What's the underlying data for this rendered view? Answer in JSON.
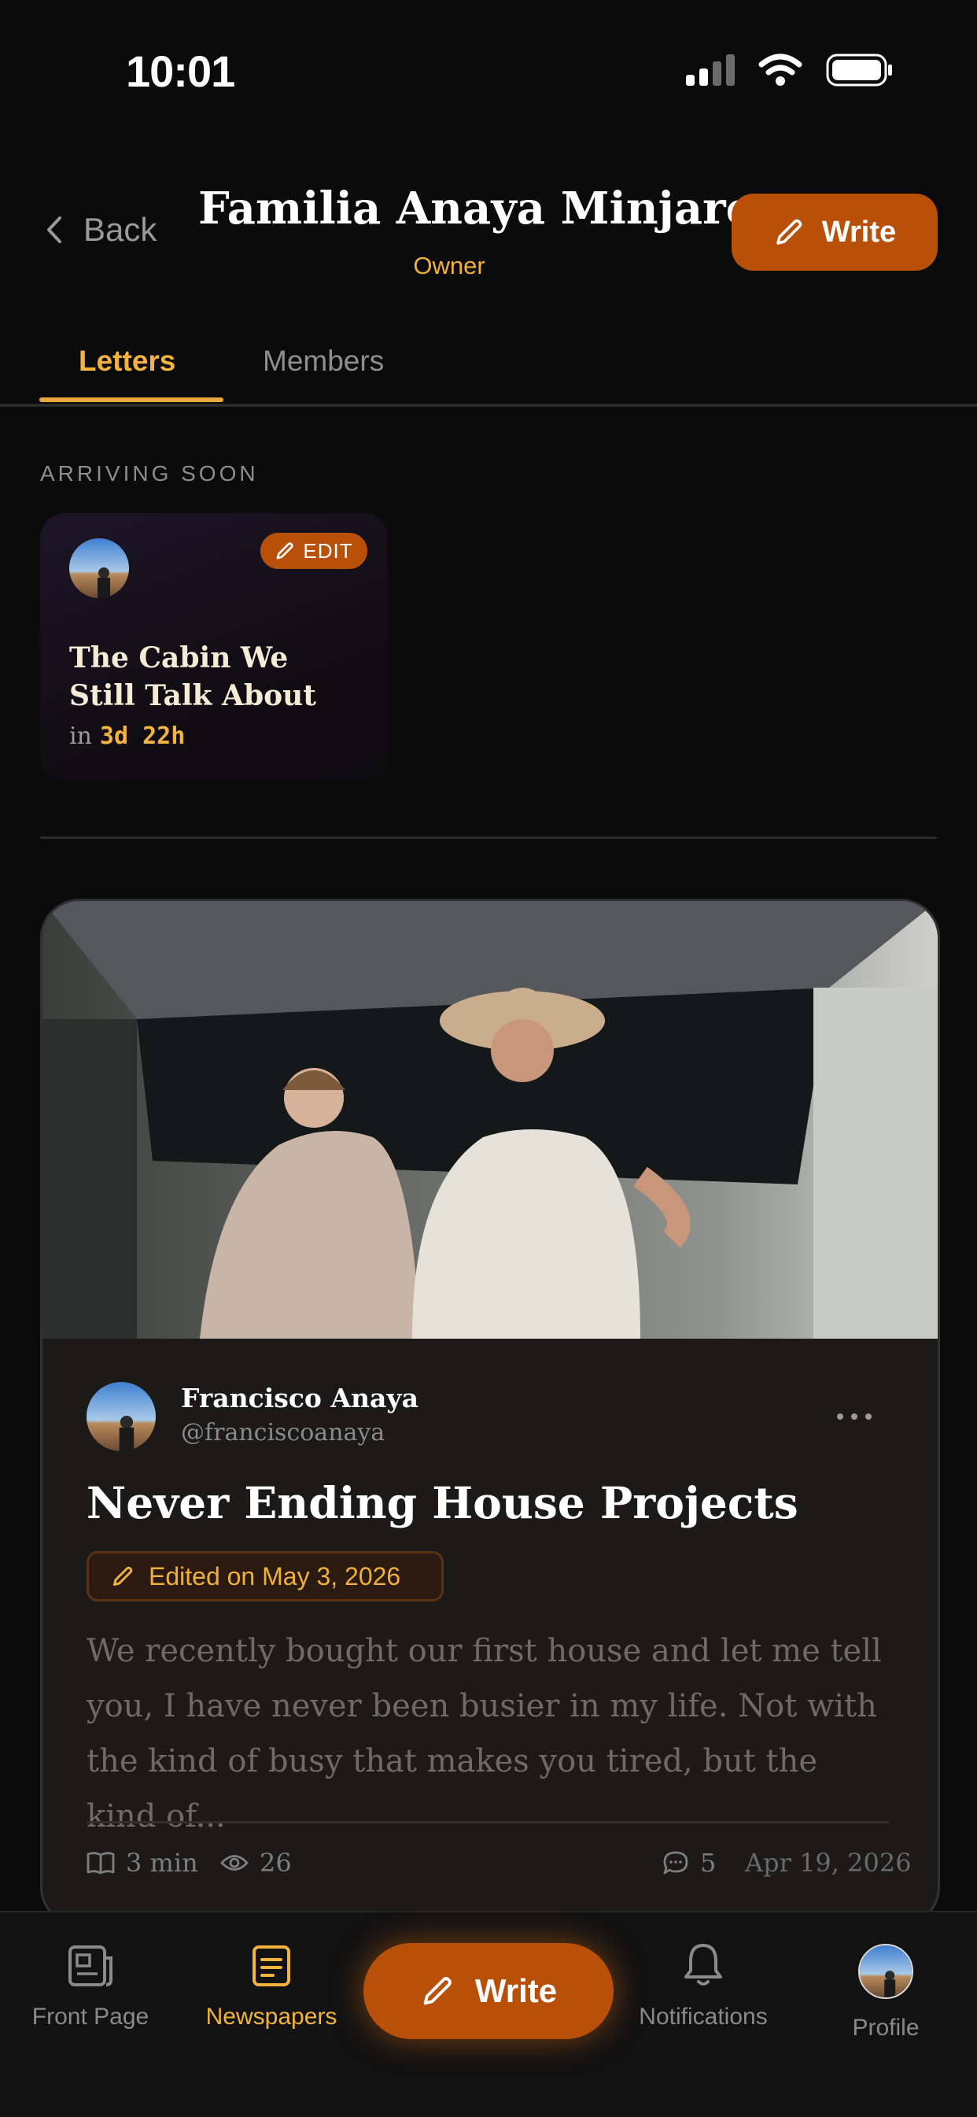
{
  "status_bar": {
    "time": "10:01"
  },
  "header": {
    "back_label": "Back",
    "title": "Familia Anaya Minjarez",
    "role": "Owner",
    "write_label": "Write"
  },
  "tabs": [
    {
      "label": "Letters",
      "active": true
    },
    {
      "label": "Members",
      "active": false
    }
  ],
  "arriving_soon": {
    "heading": "ARRIVING SOON",
    "card": {
      "edit_label": "EDIT",
      "title": "The Cabin We Still Talk About",
      "in_label": "in",
      "countdown": "3d 22h"
    }
  },
  "post": {
    "author_name": "Francisco Anaya",
    "author_handle": "@franciscoanaya",
    "title": "Never Ending House Projects",
    "edited_label": "Edited on May 3, 2026",
    "excerpt": "We recently bought our first house and let me tell you, I have never been busier in my life. Not with the kind of busy that makes you tired, but the kind of...",
    "read_time": "3 min",
    "views": "26",
    "comments": "5",
    "date": "Apr 19, 2026"
  },
  "tab_bar": {
    "front_page": "Front Page",
    "newspapers": "Newspapers",
    "write": "Write",
    "notifications": "Notifications",
    "profile": "Profile"
  },
  "colors": {
    "accent": "#b85009",
    "highlight": "#f3b33c",
    "background": "#0b0b0b",
    "card": "#1c1a19"
  }
}
